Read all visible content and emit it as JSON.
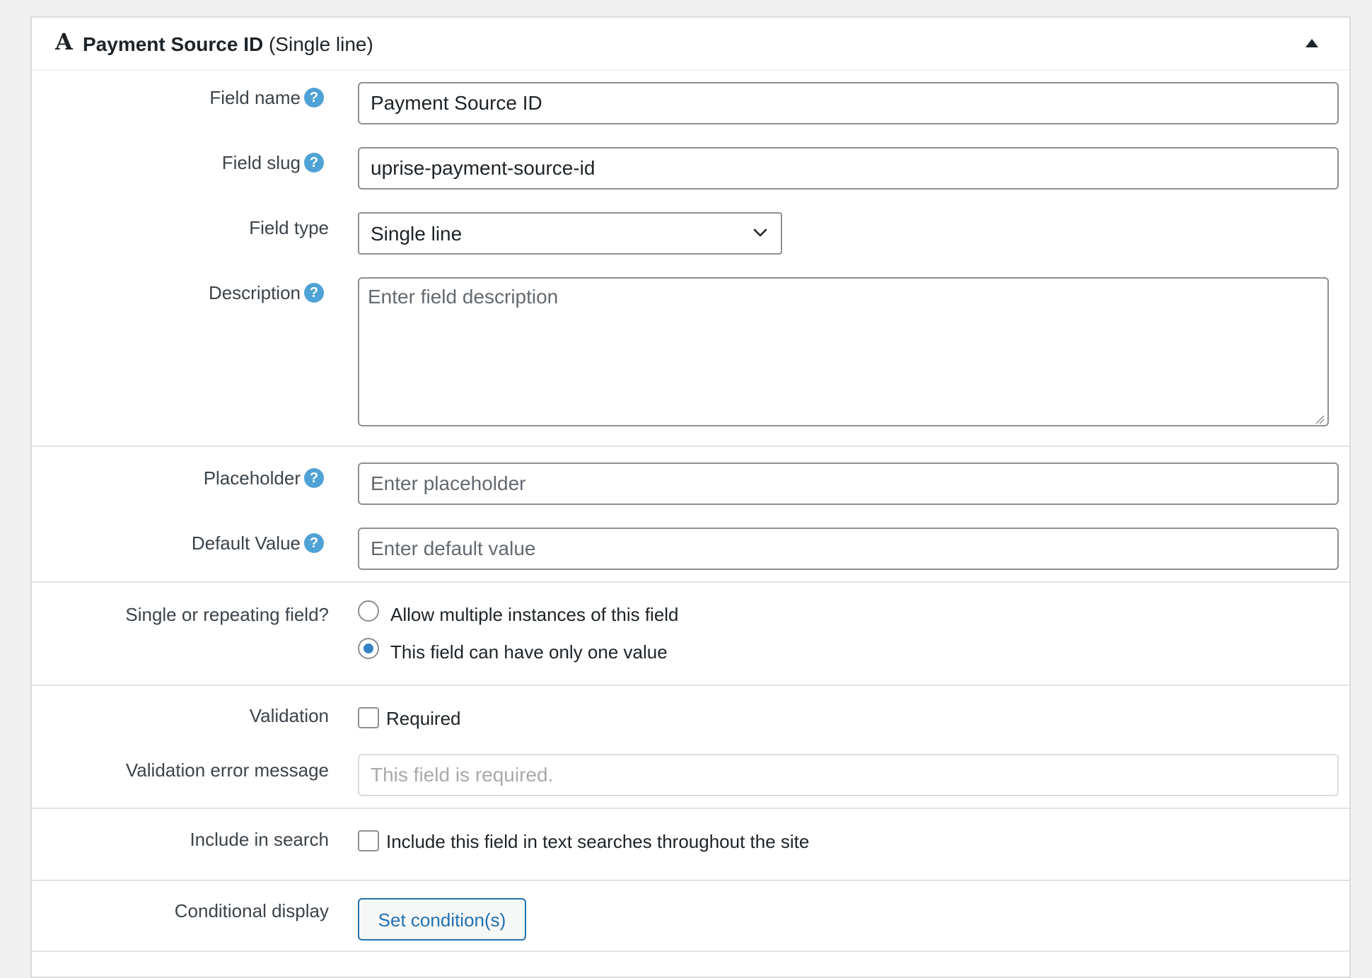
{
  "header": {
    "type_icon": "A",
    "field_name": "Payment Source ID",
    "field_type": "(Single line)",
    "collapse_icon": "triangle-up-icon"
  },
  "help_icon_glyph": "?",
  "fields": {
    "field_name": {
      "label": "Field name",
      "value": "Payment Source ID"
    },
    "field_slug": {
      "label": "Field slug",
      "value": "uprise-payment-source-id"
    },
    "field_type": {
      "label": "Field type",
      "selected": "Single line"
    },
    "description": {
      "label": "Description",
      "placeholder": "Enter field description",
      "value": ""
    },
    "placeholder": {
      "label": "Placeholder",
      "placeholder": "Enter placeholder",
      "value": ""
    },
    "default_value": {
      "label": "Default Value",
      "placeholder": "Enter default value",
      "value": ""
    },
    "repeating": {
      "label": "Single or repeating field?",
      "options": [
        {
          "label": "Allow multiple instances of this field",
          "checked": false
        },
        {
          "label": "This field can have only one value",
          "checked": true
        }
      ]
    },
    "validation": {
      "label": "Validation",
      "checkbox_label": "Required",
      "checked": false
    },
    "validation_error": {
      "label": "Validation error message",
      "placeholder": "This field is required.",
      "disabled": true
    },
    "search": {
      "label": "Include in search",
      "checkbox_label": "Include this field in text searches throughout the site",
      "checked": false
    },
    "conditional": {
      "label": "Conditional display",
      "button_label": "Set condition(s)"
    }
  },
  "colors": {
    "accent": "#2271b1",
    "help_icon": "#4fa2d6",
    "radio_dot": "#3582c4",
    "border": "#8c8f94",
    "page_bg": "#f0f0f1"
  }
}
